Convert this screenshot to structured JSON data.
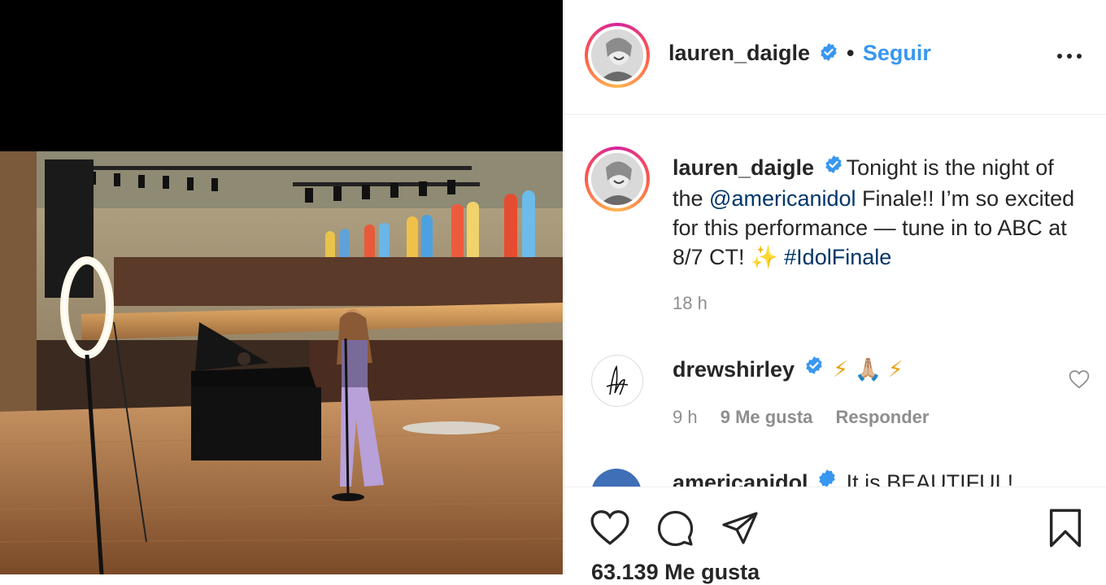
{
  "post": {
    "username": "lauren_daigle",
    "follow_label": "Seguir",
    "separator": "•",
    "more_label": "•••"
  },
  "caption": {
    "username": "lauren_daigle",
    "text_1": "Tonight is the night of the ",
    "mention": "@americanidol",
    "text_2": " Finale!! I’m so excited for this performance — tune in to ABC at 8/7 CT! ✨ ",
    "hashtag": "#IdolFinale",
    "time": "18 h"
  },
  "comments": [
    {
      "username": "drewshirley",
      "text": "⚡ 🙏🏼 ⚡",
      "time": "9 h",
      "likes": "9 Me gusta",
      "reply_label": "Responder"
    },
    {
      "username": "americanidol",
      "text": "It is BEAUTIFUL!"
    }
  ],
  "footer": {
    "likes": "63.139 Me gusta"
  },
  "colors": {
    "link_blue": "#3897f0",
    "verified_blue": "#3897f0",
    "muted_text": "#8e8e8e",
    "mention_color": "#003569"
  },
  "icons": [
    "verified-badge-icon",
    "more-options-icon",
    "heart-icon",
    "comment-icon",
    "share-icon",
    "bookmark-icon",
    "comment-like-icon"
  ]
}
